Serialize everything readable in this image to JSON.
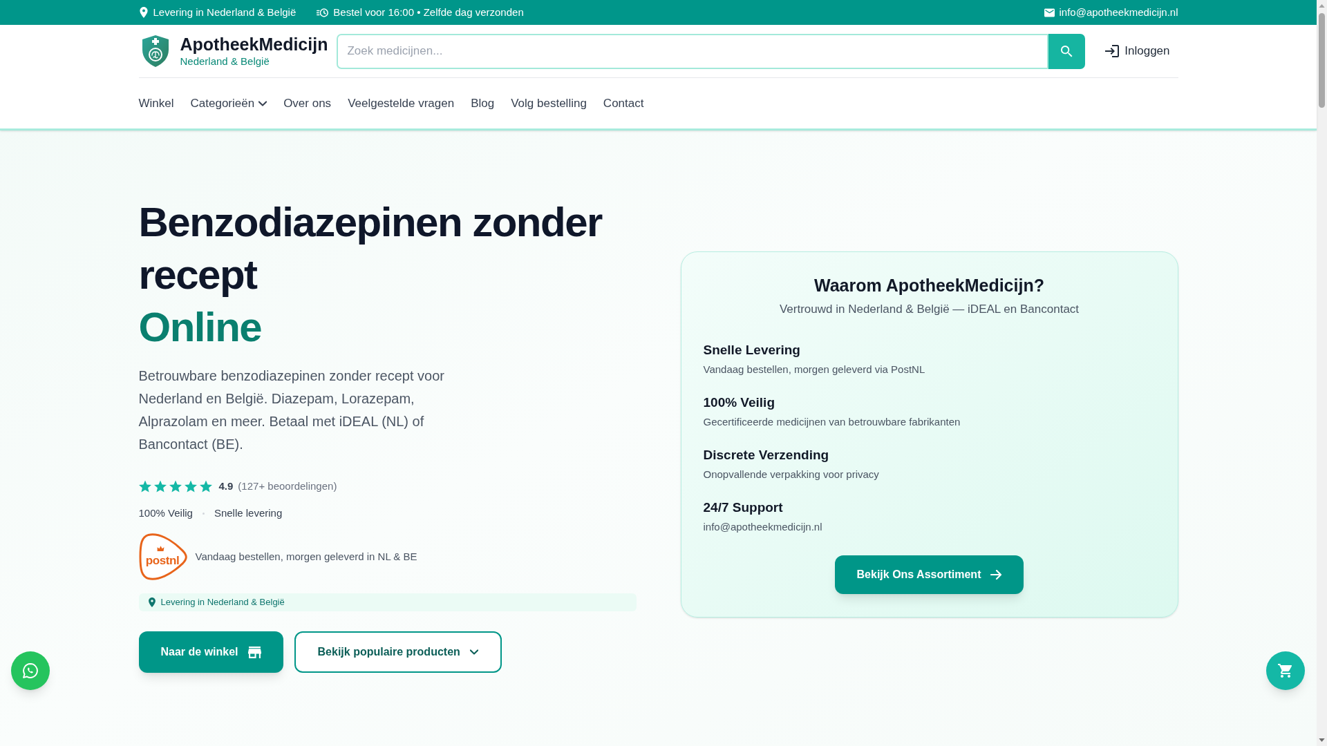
{
  "top_bar": {
    "left_items": [
      {
        "kind": "location",
        "text": "Levering in Nederland & België"
      },
      {
        "kind": "dispatch",
        "text": "Bestel voor 16:00 • Zelfde dag verzonden"
      }
    ],
    "right_items": [
      {
        "kind": "email",
        "text": "info@apotheekmedicijn.nl"
      }
    ]
  },
  "header": {
    "site_name": "ApotheekMedicijn",
    "tagline": "Nederland & België",
    "search": {
      "placeholder": "Zoek medicijnen..."
    },
    "login": "Inloggen"
  },
  "nav": [
    {
      "label": "Winkel",
      "dropdown": false
    },
    {
      "label": "Categorieën",
      "dropdown": true
    },
    {
      "label": "Over ons",
      "dropdown": false
    },
    {
      "label": "Veelgestelde vragen",
      "dropdown": false
    },
    {
      "label": "Blog",
      "dropdown": false
    },
    {
      "label": "Volg bestelling",
      "dropdown": false
    },
    {
      "label": "Contact",
      "dropdown": false
    }
  ],
  "hero": {
    "title": "Benzodiazepinen zonder recept",
    "title_accent": "Online",
    "description": "Betrouwbare benzodiazepinen zonder recept voor Nederland en België. Diazepam, Lorazepam, Alprazolam en meer. Betaal met iDEAL (NL) of Bancontact (BE).",
    "rating": {
      "stars": 5,
      "score": "4.9",
      "count": "(127+ beoordelingen)"
    },
    "badges": [
      "100% Veilig",
      "Snelle levering"
    ],
    "carrier": {
      "logo_text": "postnl",
      "note": "Vandaag bestellen, morgen geleverd in NL & BE"
    },
    "region_note": "Levering in Nederland & België",
    "buttons": [
      {
        "kind": "primary",
        "label": "Naar de winkel"
      },
      {
        "kind": "outline",
        "label": "Bekijk populaire producten"
      }
    ]
  },
  "why_card": {
    "title": "Waarom ApotheekMedicijn?",
    "subtitle": "Vertrouwd in Nederland & België — iDEAL en Bancontact",
    "features": [
      {
        "title": "Snelle Levering",
        "text": "Vandaag bestellen, morgen geleverd via PostNL"
      },
      {
        "title": "100% Veilig",
        "text": "Gecertificeerde medicijnen van betrouwbare fabrikanten"
      },
      {
        "title": "Discrete Verzending",
        "text": "Onopvallende verpakking voor privacy"
      },
      {
        "title": "24/7 Support",
        "text": "info@apotheekmedicijn.nl"
      }
    ],
    "button": "Bekijk Ons Assortiment"
  }
}
